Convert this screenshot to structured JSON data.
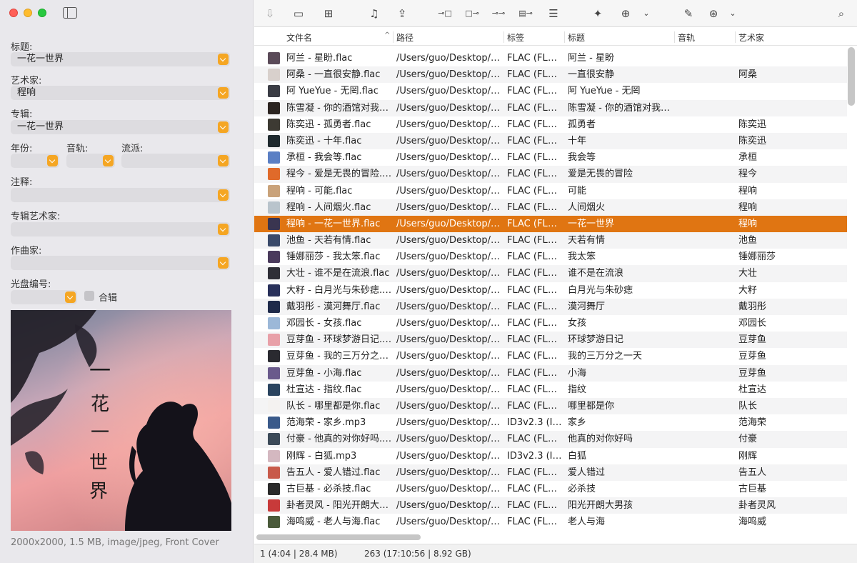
{
  "window": {
    "toolbar_icons": [
      "download-icon",
      "folder-icon",
      "folder-add-icon",
      "music-list-icon",
      "share-icon",
      "tag-to-file-icon",
      "file-to-tag-icon",
      "tag-to-tag-icon",
      "file-to-file-icon",
      "numbering-icon",
      "magic-wand-icon",
      "import-icon",
      "chevron-down-icon",
      "edit-icon",
      "globe-icon",
      "chevron-down-icon",
      "search-icon"
    ]
  },
  "sidebar": {
    "title_label": "标题:",
    "title_value": "一花一世界",
    "artist_label": "艺术家:",
    "artist_value": "程响",
    "album_label": "专辑:",
    "album_value": "一花一世界",
    "year_label": "年份:",
    "year_value": "",
    "track_label": "音轨:",
    "track_value": "",
    "genre_label": "流派:",
    "genre_value": "",
    "comment_label": "注释:",
    "comment_value": "",
    "album_artist_label": "专辑艺术家:",
    "album_artist_value": "",
    "composer_label": "作曲家:",
    "composer_value": "",
    "disc_label": "光盘编号:",
    "disc_value": "",
    "compilation_label": "合辑",
    "cover_title": "一花一世界",
    "cover_info": "2000x2000, 1.5 MB, image/jpeg, Front Cover"
  },
  "table": {
    "columns": {
      "filename": "文件名",
      "path": "路径",
      "tag": "标签",
      "title": "标题",
      "track": "音轨",
      "artist": "艺术家"
    },
    "rows": [
      {
        "filename": "阿兰 - 星盼.flac",
        "path": "/Users/guo/Desktop/…",
        "tag": "FLAC (FLA…",
        "title": "阿兰 - 星盼",
        "artist": "",
        "thumb": "#5a4a58"
      },
      {
        "filename": "阿桑 - 一直很安静.flac",
        "path": "/Users/guo/Desktop/…",
        "tag": "FLAC (FLA…",
        "title": "一直很安静",
        "artist": "阿桑",
        "thumb": "#d8d0cc"
      },
      {
        "filename": "阿 YueYue - 无罔.flac",
        "path": "/Users/guo/Desktop/…",
        "tag": "FLAC (FLA…",
        "title": "阿 YueYue - 无罔",
        "artist": "",
        "thumb": "#3a3c44"
      },
      {
        "filename": "陈雪凝 - 你的酒馆对我…",
        "path": "/Users/guo/Desktop/…",
        "tag": "FLAC (FLA…",
        "title": "陈雪凝 - 你的酒馆对我…",
        "artist": "",
        "thumb": "#2b2420"
      },
      {
        "filename": "陈奕迅 - 孤勇者.flac",
        "path": "/Users/guo/Desktop/…",
        "tag": "FLAC (FLA…",
        "title": "孤勇者",
        "artist": "陈奕迅",
        "thumb": "#3d3a33"
      },
      {
        "filename": "陈奕迅 - 十年.flac",
        "path": "/Users/guo/Desktop/…",
        "tag": "FLAC (FLA…",
        "title": "十年",
        "artist": "陈奕迅",
        "thumb": "#1f2a2e"
      },
      {
        "filename": "承桓 - 我会等.flac",
        "path": "/Users/guo/Desktop/…",
        "tag": "FLAC (FLA…",
        "title": "我会等",
        "artist": "承桓",
        "thumb": "#5a7fc4"
      },
      {
        "filename": "程今 - 爱是无畏的冒险.…",
        "path": "/Users/guo/Desktop/…",
        "tag": "FLAC (FLA…",
        "title": "爱是无畏的冒险",
        "artist": "程今",
        "thumb": "#e06a2a"
      },
      {
        "filename": "程响 - 可能.flac",
        "path": "/Users/guo/Desktop/…",
        "tag": "FLAC (FLA…",
        "title": "可能",
        "artist": "程响",
        "thumb": "#c9a27a"
      },
      {
        "filename": "程响 - 人间烟火.flac",
        "path": "/Users/guo/Desktop/…",
        "tag": "FLAC (FLA…",
        "title": "人间烟火",
        "artist": "程响",
        "thumb": "#b9c4cc"
      },
      {
        "filename": "程响 - 一花一世界.flac",
        "path": "/Users/guo/Desktop/…",
        "tag": "FLAC (FLA…",
        "title": "一花一世界",
        "artist": "程响",
        "thumb": "#3a3550",
        "selected": true
      },
      {
        "filename": "池鱼 - 天若有情.flac",
        "path": "/Users/guo/Desktop/…",
        "tag": "FLAC (FLA…",
        "title": "天若有情",
        "artist": "池鱼",
        "thumb": "#3a4a6a"
      },
      {
        "filename": "锤娜丽莎 - 我太笨.flac",
        "path": "/Users/guo/Desktop/…",
        "tag": "FLAC (FLA…",
        "title": "我太笨",
        "artist": "锤娜丽莎",
        "thumb": "#4a3a5c"
      },
      {
        "filename": "大壮 - 谁不是在流浪.flac",
        "path": "/Users/guo/Desktop/…",
        "tag": "FLAC (FLA…",
        "title": "谁不是在流浪",
        "artist": "大壮",
        "thumb": "#2e2e36"
      },
      {
        "filename": "大籽 - 白月光与朱砂痣.…",
        "path": "/Users/guo/Desktop/…",
        "tag": "FLAC (FLA…",
        "title": "白月光与朱砂痣",
        "artist": "大籽",
        "thumb": "#28305a"
      },
      {
        "filename": "戴羽彤 - 漠河舞厅.flac",
        "path": "/Users/guo/Desktop/…",
        "tag": "FLAC (FLA…",
        "title": "漠河舞厅",
        "artist": "戴羽彤",
        "thumb": "#1e2a4a"
      },
      {
        "filename": "邓园长 - 女孩.flac",
        "path": "/Users/guo/Desktop/…",
        "tag": "FLAC (FLA…",
        "title": "女孩",
        "artist": "邓园长",
        "thumb": "#9cb8d8"
      },
      {
        "filename": "豆芽鱼 - 环球梦游日记.…",
        "path": "/Users/guo/Desktop/…",
        "tag": "FLAC (FLA…",
        "title": "环球梦游日记",
        "artist": "豆芽鱼",
        "thumb": "#e8a0a8"
      },
      {
        "filename": "豆芽鱼 - 我的三万分之…",
        "path": "/Users/guo/Desktop/…",
        "tag": "FLAC (FLA…",
        "title": "我的三万分之一天",
        "artist": "豆芽鱼",
        "thumb": "#2a2a30"
      },
      {
        "filename": "豆芽鱼 - 小海.flac",
        "path": "/Users/guo/Desktop/…",
        "tag": "FLAC (FLA…",
        "title": "小海",
        "artist": "豆芽鱼",
        "thumb": "#6a5a8c"
      },
      {
        "filename": "杜宣达 - 指纹.flac",
        "path": "/Users/guo/Desktop/…",
        "tag": "FLAC (FLA…",
        "title": "指纹",
        "artist": "杜宣达",
        "thumb": "#2a4460"
      },
      {
        "filename": "队长 - 哪里都是你.flac",
        "path": "/Users/guo/Desktop/…",
        "tag": "FLAC (FLA…",
        "title": "哪里都是你",
        "artist": "队长",
        "thumb": "#f4f2f0"
      },
      {
        "filename": "范海荣 - 家乡.mp3",
        "path": "/Users/guo/Desktop/…",
        "tag": "ID3v2.3 (I…",
        "title": "家乡",
        "artist": "范海荣",
        "thumb": "#3a5a8a"
      },
      {
        "filename": "付豪 - 他真的对你好吗.…",
        "path": "/Users/guo/Desktop/…",
        "tag": "FLAC (FLA…",
        "title": "他真的对你好吗",
        "artist": "付豪",
        "thumb": "#3c4a58"
      },
      {
        "filename": "刚辉 - 白狐.mp3",
        "path": "/Users/guo/Desktop/…",
        "tag": "ID3v2.3 (I…",
        "title": "白狐",
        "artist": "刚辉",
        "thumb": "#d4b8c0"
      },
      {
        "filename": "告五人 - 爱人错过.flac",
        "path": "/Users/guo/Desktop/…",
        "tag": "FLAC (FLA…",
        "title": "爱人错过",
        "artist": "告五人",
        "thumb": "#c85a4a"
      },
      {
        "filename": "古巨基 - 必杀技.flac",
        "path": "/Users/guo/Desktop/…",
        "tag": "FLAC (FLA…",
        "title": "必杀技",
        "artist": "古巨基",
        "thumb": "#2a2a2a"
      },
      {
        "filename": "卦者灵风 - 阳光开朗大…",
        "path": "/Users/guo/Desktop/…",
        "tag": "FLAC (FLA…",
        "title": "阳光开朗大男孩",
        "artist": "卦者灵风",
        "thumb": "#c83a3a"
      },
      {
        "filename": "海鸣威 - 老人与海.flac",
        "path": "/Users/guo/Desktop/…",
        "tag": "FLAC (FLA…",
        "title": "老人与海",
        "artist": "海鸣威",
        "thumb": "#4a5a3a"
      }
    ]
  },
  "status": {
    "selection": "1 (4:04 | 28.4 MB)",
    "total": "263 (17:10:56 | 8.92 GB)"
  }
}
